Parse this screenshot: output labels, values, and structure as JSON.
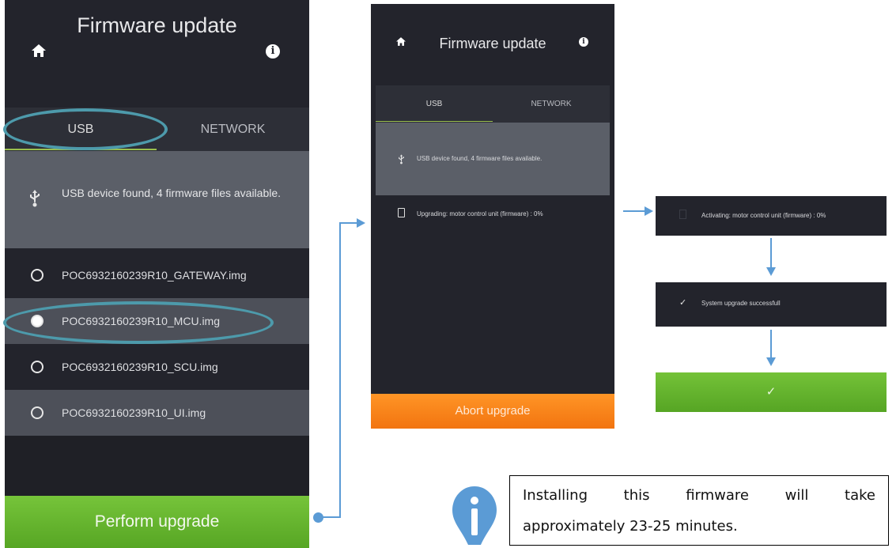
{
  "screen1": {
    "title": "Firmware update",
    "tabs": [
      "USB",
      "NETWORK"
    ],
    "usb_message": "USB device found, 4 firmware files available.",
    "files": [
      {
        "name": "POC6932160239R10_GATEWAY.img",
        "selected": false
      },
      {
        "name": "POC6932160239R10_MCU.img",
        "selected": true
      },
      {
        "name": "POC6932160239R10_SCU.img",
        "selected": false
      },
      {
        "name": "POC6932160239R10_UI.img",
        "selected": false
      }
    ],
    "button_label": "Perform upgrade"
  },
  "screen2": {
    "title": "Firmware update",
    "tabs": [
      "USB",
      "NETWORK"
    ],
    "usb_message": "USB device found, 4 firmware files available.",
    "status": "Upgrading: motor control unit (firmware) : 0%",
    "button_label": "Abort upgrade"
  },
  "screen3": {
    "activating": "Activating: motor control unit (firmware) : 0%",
    "success": "System upgrade successfull",
    "check": "✓"
  },
  "note": {
    "line1": "Installing this firmware will take",
    "line2": "approximately 23-25 minutes."
  },
  "colors": {
    "accent_green": "#6bbb30",
    "accent_orange": "#f7821a",
    "arrow_blue": "#5b9bd5",
    "highlight_oval": "#4d9aab"
  }
}
